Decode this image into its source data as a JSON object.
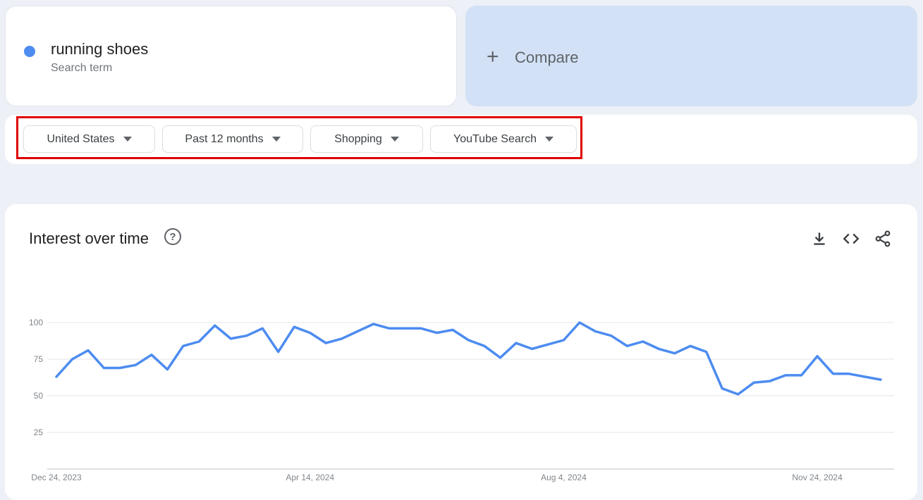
{
  "search_term": {
    "name": "running shoes",
    "subtitle": "Search term",
    "color": "#4d8cf0"
  },
  "compare": {
    "icon": "plus-icon",
    "label": "Compare"
  },
  "filters": [
    {
      "label": "United States",
      "icon": "caret-down-icon"
    },
    {
      "label": "Past 12 months",
      "icon": "caret-down-icon"
    },
    {
      "label": "Shopping",
      "icon": "caret-down-icon"
    },
    {
      "label": "YouTube Search",
      "icon": "caret-down-icon"
    }
  ],
  "highlight_color": "#e00000",
  "chart_section": {
    "title": "Interest over time",
    "help_icon": "help-icon",
    "tools": [
      "download-icon",
      "embed-code-icon",
      "share-icon"
    ]
  },
  "chart_data": {
    "type": "line",
    "title": "Interest over time",
    "xlabel": "",
    "ylabel": "",
    "ylim": [
      0,
      100
    ],
    "yticks": [
      25,
      50,
      75,
      100
    ],
    "x_tick_labels": [
      "Dec 24, 2023",
      "Apr 14, 2024",
      "Aug 4, 2024",
      "Nov 24, 2024"
    ],
    "x_tick_indices": [
      0,
      16,
      32,
      48
    ],
    "grid": true,
    "series": [
      {
        "color": "#4d8cf0",
        "values": [
          63,
          75,
          81,
          69,
          69,
          71,
          78,
          68,
          84,
          87,
          98,
          89,
          91,
          96,
          80,
          97,
          93,
          86,
          89,
          94,
          99,
          96,
          96,
          96,
          93,
          95,
          88,
          84,
          76,
          86,
          82,
          85,
          88,
          100,
          94,
          91,
          84,
          87,
          82,
          79,
          84,
          80,
          55,
          51,
          59,
          60,
          64,
          64,
          77,
          65,
          65,
          63,
          61
        ]
      }
    ]
  }
}
